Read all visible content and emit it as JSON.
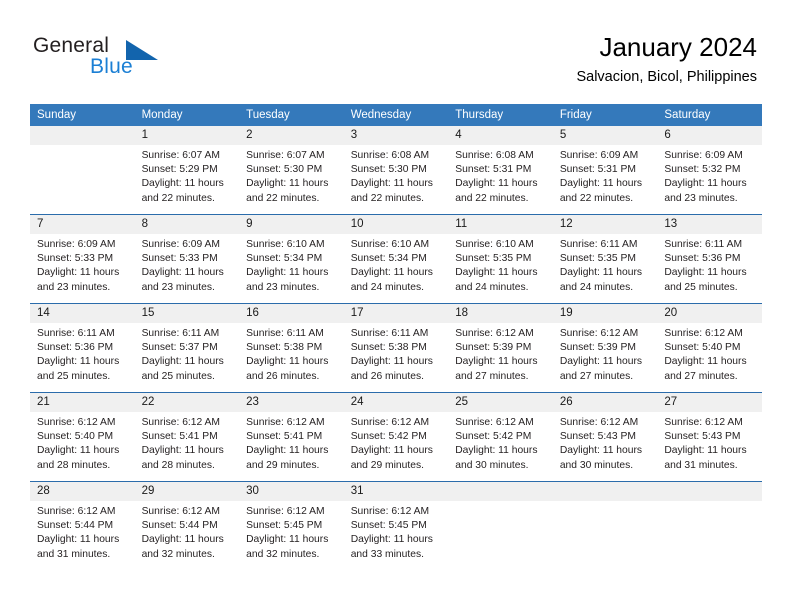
{
  "logo": {
    "word_one": "General",
    "word_two": "Blue",
    "triangle_color": "#1264ad",
    "blue_color": "#1b7fd4"
  },
  "header": {
    "title": "January 2024",
    "subtitle": "Salvacion, Bicol, Philippines",
    "accent_color": "#3479bb"
  },
  "calendar": {
    "weekday_headers": [
      "Sunday",
      "Monday",
      "Tuesday",
      "Wednesday",
      "Thursday",
      "Friday",
      "Saturday"
    ],
    "weeks": [
      [
        {
          "day": "",
          "sunrise": "",
          "sunset": "",
          "daylight_line1": "",
          "daylight_line2": ""
        },
        {
          "day": "1",
          "sunrise": "Sunrise: 6:07 AM",
          "sunset": "Sunset: 5:29 PM",
          "daylight_line1": "Daylight: 11 hours",
          "daylight_line2": "and 22 minutes."
        },
        {
          "day": "2",
          "sunrise": "Sunrise: 6:07 AM",
          "sunset": "Sunset: 5:30 PM",
          "daylight_line1": "Daylight: 11 hours",
          "daylight_line2": "and 22 minutes."
        },
        {
          "day": "3",
          "sunrise": "Sunrise: 6:08 AM",
          "sunset": "Sunset: 5:30 PM",
          "daylight_line1": "Daylight: 11 hours",
          "daylight_line2": "and 22 minutes."
        },
        {
          "day": "4",
          "sunrise": "Sunrise: 6:08 AM",
          "sunset": "Sunset: 5:31 PM",
          "daylight_line1": "Daylight: 11 hours",
          "daylight_line2": "and 22 minutes."
        },
        {
          "day": "5",
          "sunrise": "Sunrise: 6:09 AM",
          "sunset": "Sunset: 5:31 PM",
          "daylight_line1": "Daylight: 11 hours",
          "daylight_line2": "and 22 minutes."
        },
        {
          "day": "6",
          "sunrise": "Sunrise: 6:09 AM",
          "sunset": "Sunset: 5:32 PM",
          "daylight_line1": "Daylight: 11 hours",
          "daylight_line2": "and 23 minutes."
        }
      ],
      [
        {
          "day": "7",
          "sunrise": "Sunrise: 6:09 AM",
          "sunset": "Sunset: 5:33 PM",
          "daylight_line1": "Daylight: 11 hours",
          "daylight_line2": "and 23 minutes."
        },
        {
          "day": "8",
          "sunrise": "Sunrise: 6:09 AM",
          "sunset": "Sunset: 5:33 PM",
          "daylight_line1": "Daylight: 11 hours",
          "daylight_line2": "and 23 minutes."
        },
        {
          "day": "9",
          "sunrise": "Sunrise: 6:10 AM",
          "sunset": "Sunset: 5:34 PM",
          "daylight_line1": "Daylight: 11 hours",
          "daylight_line2": "and 23 minutes."
        },
        {
          "day": "10",
          "sunrise": "Sunrise: 6:10 AM",
          "sunset": "Sunset: 5:34 PM",
          "daylight_line1": "Daylight: 11 hours",
          "daylight_line2": "and 24 minutes."
        },
        {
          "day": "11",
          "sunrise": "Sunrise: 6:10 AM",
          "sunset": "Sunset: 5:35 PM",
          "daylight_line1": "Daylight: 11 hours",
          "daylight_line2": "and 24 minutes."
        },
        {
          "day": "12",
          "sunrise": "Sunrise: 6:11 AM",
          "sunset": "Sunset: 5:35 PM",
          "daylight_line1": "Daylight: 11 hours",
          "daylight_line2": "and 24 minutes."
        },
        {
          "day": "13",
          "sunrise": "Sunrise: 6:11 AM",
          "sunset": "Sunset: 5:36 PM",
          "daylight_line1": "Daylight: 11 hours",
          "daylight_line2": "and 25 minutes."
        }
      ],
      [
        {
          "day": "14",
          "sunrise": "Sunrise: 6:11 AM",
          "sunset": "Sunset: 5:36 PM",
          "daylight_line1": "Daylight: 11 hours",
          "daylight_line2": "and 25 minutes."
        },
        {
          "day": "15",
          "sunrise": "Sunrise: 6:11 AM",
          "sunset": "Sunset: 5:37 PM",
          "daylight_line1": "Daylight: 11 hours",
          "daylight_line2": "and 25 minutes."
        },
        {
          "day": "16",
          "sunrise": "Sunrise: 6:11 AM",
          "sunset": "Sunset: 5:38 PM",
          "daylight_line1": "Daylight: 11 hours",
          "daylight_line2": "and 26 minutes."
        },
        {
          "day": "17",
          "sunrise": "Sunrise: 6:11 AM",
          "sunset": "Sunset: 5:38 PM",
          "daylight_line1": "Daylight: 11 hours",
          "daylight_line2": "and 26 minutes."
        },
        {
          "day": "18",
          "sunrise": "Sunrise: 6:12 AM",
          "sunset": "Sunset: 5:39 PM",
          "daylight_line1": "Daylight: 11 hours",
          "daylight_line2": "and 27 minutes."
        },
        {
          "day": "19",
          "sunrise": "Sunrise: 6:12 AM",
          "sunset": "Sunset: 5:39 PM",
          "daylight_line1": "Daylight: 11 hours",
          "daylight_line2": "and 27 minutes."
        },
        {
          "day": "20",
          "sunrise": "Sunrise: 6:12 AM",
          "sunset": "Sunset: 5:40 PM",
          "daylight_line1": "Daylight: 11 hours",
          "daylight_line2": "and 27 minutes."
        }
      ],
      [
        {
          "day": "21",
          "sunrise": "Sunrise: 6:12 AM",
          "sunset": "Sunset: 5:40 PM",
          "daylight_line1": "Daylight: 11 hours",
          "daylight_line2": "and 28 minutes."
        },
        {
          "day": "22",
          "sunrise": "Sunrise: 6:12 AM",
          "sunset": "Sunset: 5:41 PM",
          "daylight_line1": "Daylight: 11 hours",
          "daylight_line2": "and 28 minutes."
        },
        {
          "day": "23",
          "sunrise": "Sunrise: 6:12 AM",
          "sunset": "Sunset: 5:41 PM",
          "daylight_line1": "Daylight: 11 hours",
          "daylight_line2": "and 29 minutes."
        },
        {
          "day": "24",
          "sunrise": "Sunrise: 6:12 AM",
          "sunset": "Sunset: 5:42 PM",
          "daylight_line1": "Daylight: 11 hours",
          "daylight_line2": "and 29 minutes."
        },
        {
          "day": "25",
          "sunrise": "Sunrise: 6:12 AM",
          "sunset": "Sunset: 5:42 PM",
          "daylight_line1": "Daylight: 11 hours",
          "daylight_line2": "and 30 minutes."
        },
        {
          "day": "26",
          "sunrise": "Sunrise: 6:12 AM",
          "sunset": "Sunset: 5:43 PM",
          "daylight_line1": "Daylight: 11 hours",
          "daylight_line2": "and 30 minutes."
        },
        {
          "day": "27",
          "sunrise": "Sunrise: 6:12 AM",
          "sunset": "Sunset: 5:43 PM",
          "daylight_line1": "Daylight: 11 hours",
          "daylight_line2": "and 31 minutes."
        }
      ],
      [
        {
          "day": "28",
          "sunrise": "Sunrise: 6:12 AM",
          "sunset": "Sunset: 5:44 PM",
          "daylight_line1": "Daylight: 11 hours",
          "daylight_line2": "and 31 minutes."
        },
        {
          "day": "29",
          "sunrise": "Sunrise: 6:12 AM",
          "sunset": "Sunset: 5:44 PM",
          "daylight_line1": "Daylight: 11 hours",
          "daylight_line2": "and 32 minutes."
        },
        {
          "day": "30",
          "sunrise": "Sunrise: 6:12 AM",
          "sunset": "Sunset: 5:45 PM",
          "daylight_line1": "Daylight: 11 hours",
          "daylight_line2": "and 32 minutes."
        },
        {
          "day": "31",
          "sunrise": "Sunrise: 6:12 AM",
          "sunset": "Sunset: 5:45 PM",
          "daylight_line1": "Daylight: 11 hours",
          "daylight_line2": "and 33 minutes."
        },
        {
          "day": "",
          "sunrise": "",
          "sunset": "",
          "daylight_line1": "",
          "daylight_line2": ""
        },
        {
          "day": "",
          "sunrise": "",
          "sunset": "",
          "daylight_line1": "",
          "daylight_line2": ""
        },
        {
          "day": "",
          "sunrise": "",
          "sunset": "",
          "daylight_line1": "",
          "daylight_line2": ""
        }
      ]
    ]
  }
}
